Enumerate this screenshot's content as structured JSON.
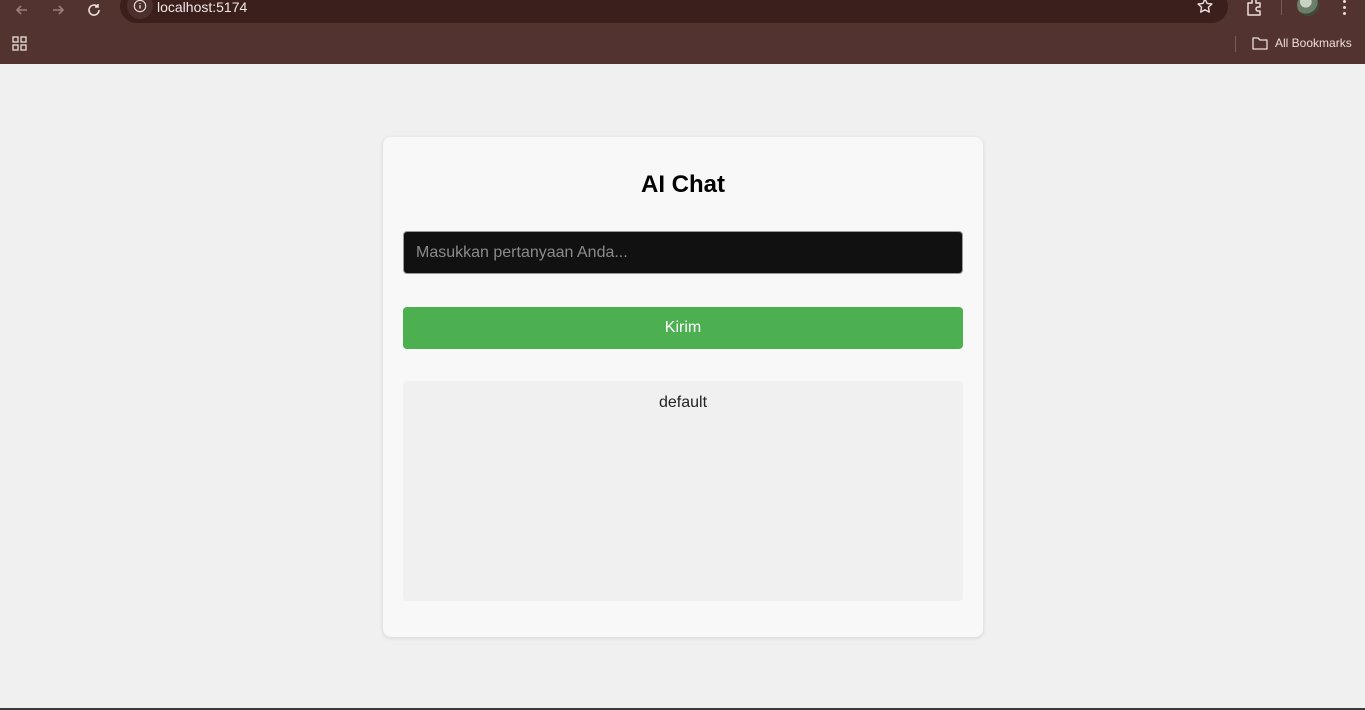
{
  "browser": {
    "url": "localhost:5174",
    "bookmarks_label": "All Bookmarks"
  },
  "app": {
    "title": "AI Chat",
    "input_placeholder": "Masukkan pertanyaan Anda...",
    "input_value": "",
    "send_label": "Kirim",
    "response_text": "default"
  },
  "colors": {
    "accent": "#4caf50",
    "chrome": "#523330",
    "input_bg": "#111111"
  }
}
